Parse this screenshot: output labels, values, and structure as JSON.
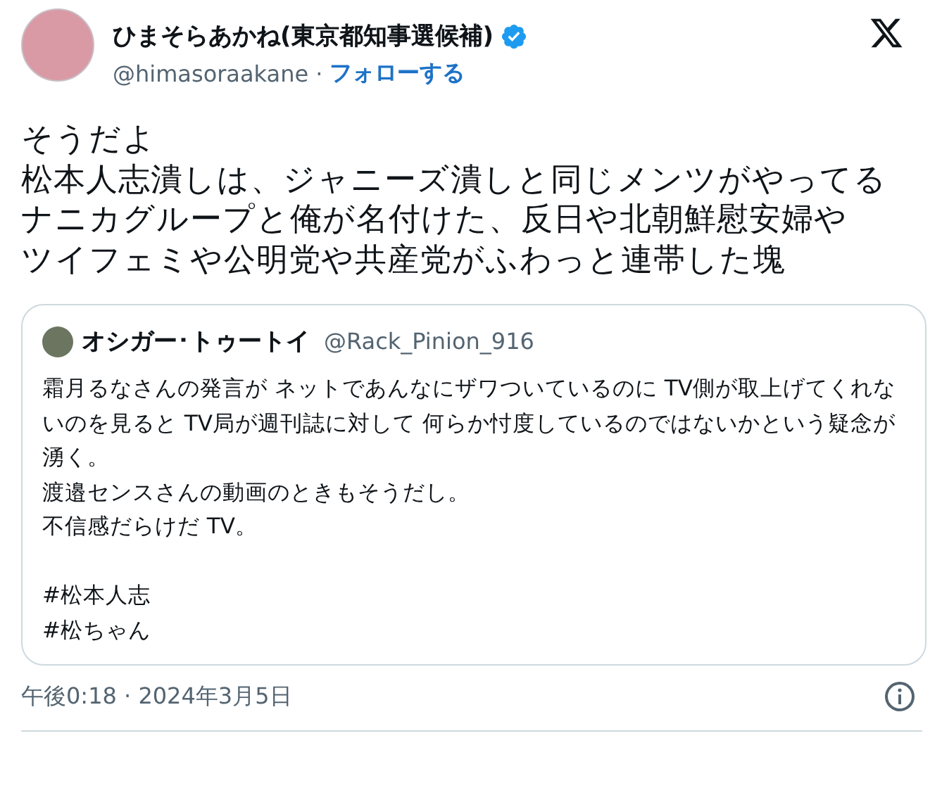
{
  "author": {
    "name": "ひまそらあかね(東京都知事選候補)",
    "verified": true,
    "handle": "@himasoraakane",
    "separator": "·",
    "follow": "フォローする"
  },
  "text_lines": [
    "そうだよ",
    "松本人志潰しは、ジャニーズ潰しと同じメンツがやってる",
    "ナニカグループと俺が名付けた、反日や北朝鮮慰安婦や",
    "ツイフェミや公明党や共産党がふわっと連帯した塊"
  ],
  "quote": {
    "name": "オシガー･トゥートイ",
    "handle": "@Rack_Pinion_916",
    "lines": [
      "霜月るなさんの発言が ネットであんなにザワついているのに TV側が取上げてくれないのを見ると TV局が週刊誌に対して 何らか忖度しているのではないかという疑念が湧く。",
      "渡邉センスさんの動画のときもそうだし。",
      "不信感だらけだ TV。"
    ],
    "hashtags": [
      "#松本人志",
      "#松ちゃん"
    ]
  },
  "timestamp": "午後0:18 · 2024年3月5日"
}
